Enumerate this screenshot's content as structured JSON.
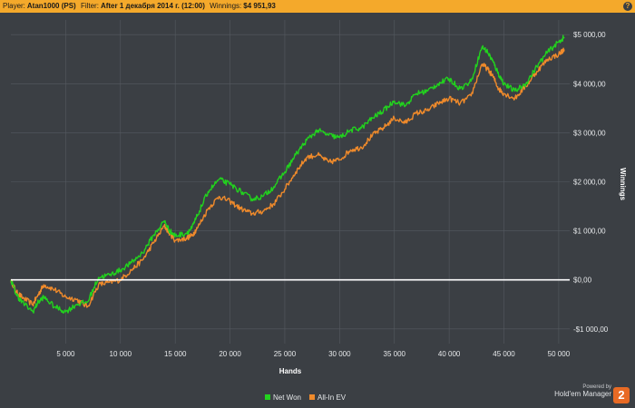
{
  "header": {
    "player_label": "Player:",
    "player_value": "Atan1000 (PS)",
    "filter_label": "Filter:",
    "filter_value": "After 1 декабря 2014 г. (12:00)",
    "winnings_label": "Winnings:",
    "winnings_value": "$4 951,93",
    "help_icon": "?"
  },
  "footer": {
    "powered_by": "Powered by",
    "brand": "Hold'em Manager",
    "brand_badge": "2"
  },
  "colors": {
    "net_won": "#22d21e",
    "all_in_ev": "#ef8a2b",
    "zero_line": "#ffffff",
    "grid": "#555a60",
    "background": "#3b3f44",
    "header_bar": "#f4a92b"
  },
  "chart_data": {
    "type": "line",
    "xlabel": "Hands",
    "ylabel": "Winnings",
    "xlim": [
      0,
      51000
    ],
    "ylim": [
      -1300,
      5300
    ],
    "x_ticks": [
      5000,
      10000,
      15000,
      20000,
      25000,
      30000,
      35000,
      40000,
      45000,
      50000
    ],
    "x_tick_labels": [
      "5 000",
      "10 000",
      "15 000",
      "20 000",
      "25 000",
      "30 000",
      "35 000",
      "40 000",
      "45 000",
      "50 000"
    ],
    "y_ticks": [
      -1000,
      0,
      1000,
      2000,
      3000,
      4000,
      5000
    ],
    "y_tick_labels": [
      "-$1 000,00",
      "$0,00",
      "$1 000,00",
      "$2 000,00",
      "$3 000,00",
      "$4 000,00",
      "$5 000,00"
    ],
    "grid": true,
    "legend_position": "bottom-center",
    "series": [
      {
        "name": "Net Won",
        "color": "#22d21e",
        "x": [
          0,
          500,
          1000,
          2000,
          2500,
          3000,
          4000,
          5000,
          6000,
          7000,
          8000,
          9000,
          10000,
          11000,
          12000,
          13000,
          14000,
          14500,
          15000,
          16000,
          16500,
          17000,
          18000,
          19000,
          20000,
          21000,
          22000,
          23000,
          24000,
          25000,
          26000,
          27000,
          28000,
          29000,
          30000,
          31000,
          32000,
          33000,
          34000,
          35000,
          36000,
          37000,
          38000,
          39000,
          40000,
          41000,
          42000,
          43000,
          43500,
          44000,
          44500,
          45000,
          46000,
          47000,
          48000,
          49000,
          50000,
          50500
        ],
        "values": [
          0,
          -300,
          -450,
          -650,
          -450,
          -350,
          -550,
          -650,
          -500,
          -450,
          50,
          100,
          200,
          350,
          550,
          900,
          1200,
          1000,
          900,
          950,
          1050,
          1300,
          1800,
          2050,
          1950,
          1800,
          1650,
          1700,
          1900,
          2200,
          2550,
          2850,
          3050,
          2950,
          2900,
          3050,
          3100,
          3300,
          3450,
          3650,
          3550,
          3800,
          3850,
          4000,
          4100,
          3900,
          4050,
          4750,
          4650,
          4450,
          4200,
          4000,
          3850,
          4000,
          4350,
          4650,
          4850,
          4950
        ]
      },
      {
        "name": "All-In EV",
        "color": "#ef8a2b",
        "x": [
          0,
          500,
          1000,
          2000,
          2500,
          3000,
          4000,
          5000,
          6000,
          7000,
          8000,
          9000,
          10000,
          11000,
          12000,
          13000,
          14000,
          14500,
          15000,
          16000,
          16500,
          17000,
          18000,
          19000,
          20000,
          21000,
          22000,
          23000,
          24000,
          25000,
          26000,
          27000,
          28000,
          29000,
          30000,
          31000,
          32000,
          33000,
          34000,
          35000,
          36000,
          37000,
          38000,
          39000,
          40000,
          41000,
          42000,
          43000,
          43500,
          44000,
          44500,
          45000,
          46000,
          47000,
          48000,
          49000,
          50000,
          50500
        ],
        "values": [
          0,
          -250,
          -350,
          -500,
          -300,
          -100,
          -200,
          -350,
          -400,
          -550,
          -100,
          -50,
          0,
          200,
          400,
          750,
          1100,
          950,
          800,
          850,
          900,
          1050,
          1450,
          1700,
          1600,
          1450,
          1350,
          1400,
          1550,
          1850,
          2200,
          2500,
          2550,
          2400,
          2450,
          2650,
          2700,
          2950,
          3100,
          3300,
          3200,
          3400,
          3450,
          3600,
          3700,
          3600,
          3750,
          4400,
          4300,
          4150,
          3900,
          3800,
          3700,
          3950,
          4250,
          4500,
          4600,
          4700
        ]
      }
    ]
  }
}
